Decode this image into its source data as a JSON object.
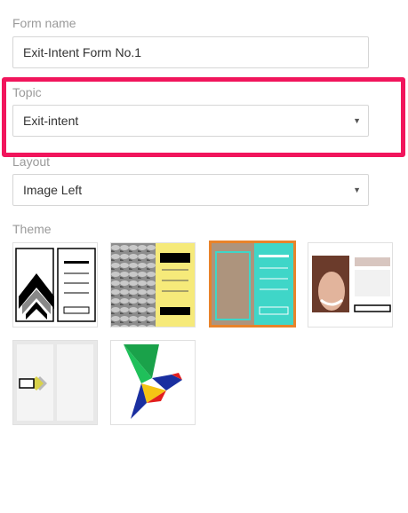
{
  "form_name": {
    "label": "Form name",
    "value": "Exit-Intent Form No.1"
  },
  "topic": {
    "label": "Topic",
    "value": "Exit-intent"
  },
  "layout": {
    "label": "Layout",
    "value": "Image Left"
  },
  "theme": {
    "label": "Theme",
    "selected_index": 2,
    "options": [
      "theme-geometric-icon",
      "theme-knit-yellow-icon",
      "theme-teal-orange-icon",
      "theme-portrait-icon",
      "theme-gray-minimal-icon",
      "theme-origami-bird-icon"
    ]
  },
  "colors": {
    "highlight": "#f1155c",
    "selected_border": "#e8832a",
    "teal": "#3fd6c8",
    "yellow": "#f6ea7a"
  }
}
